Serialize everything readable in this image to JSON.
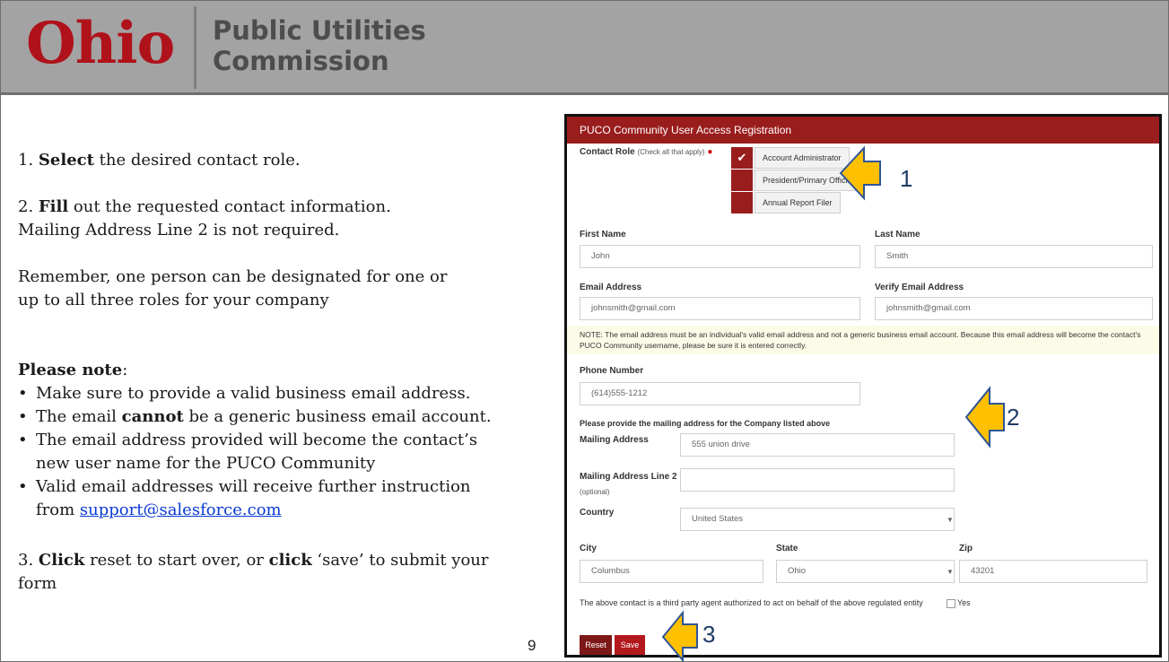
{
  "header": {
    "logo": "Ohio",
    "org_line1": "Public Utilities",
    "org_line2": "Commission"
  },
  "instructions": {
    "step1_bold": "Select",
    "step1_rest": " the desired contact role.",
    "step2_bold": "Fill",
    "step2_rest": " out the requested contact information.",
    "step2_line2": "Mailing Address Line 2 is not required.",
    "remember_line1": "Remember, one person can be designated for one or",
    "remember_line2": "up to all three roles for your company",
    "note_bold": "Please note",
    "note_colon": ":",
    "bullet1": "Make sure to provide a valid business email address.",
    "bullet2_pre": "The email ",
    "bullet2_bold": "cannot",
    "bullet2_post": " be a generic business email account.",
    "bullet3_line1": "The email address provided will become the contact’s",
    "bullet3_line2": "new user name for the PUCO Community",
    "bullet4_line1": "Valid email addresses will receive further instruction",
    "bullet4_pre": "from ",
    "bullet4_link": "support@salesforce.com",
    "step3_pre": "3. ",
    "step3_bold1": "Click",
    "step3_mid": " reset to start over, or ",
    "step3_bold2": "click",
    "step3_post": " ‘save’ to submit your",
    "step3_line2": "form",
    "step1_num": "1. ",
    "step2_num": "2. "
  },
  "slide_number": "9",
  "form": {
    "title": "PUCO Community User Access Registration",
    "contact_role_label": "Contact Role",
    "contact_role_hint": "(Check all that apply)",
    "roles": [
      {
        "label": "Account Administrator",
        "checked": true
      },
      {
        "label": "President/Primary Official",
        "checked": false
      },
      {
        "label": "Annual Report Filer",
        "checked": false
      }
    ],
    "check_glyph": "✔",
    "first_name_label": "First Name",
    "first_name_value": "John",
    "last_name_label": "Last Name",
    "last_name_value": "Smith",
    "email_label": "Email Address",
    "email_value": "johnsmith@gmail.com",
    "verify_email_label": "Verify Email Address",
    "verify_email_value": "johnsmith@gmail.com",
    "note_text": "NOTE: The email address must be an individual's valid email address and not a generic business email account. Because this email address will become the contact's PUCO Community username, please be sure it is entered correctly.",
    "phone_label": "Phone Number",
    "phone_value": "(614)555-1212",
    "mailing_intro": "Please provide the mailing address for the Company listed above",
    "mailing_label": "Mailing Address",
    "mailing_value": "555 union drive",
    "mailing2_label": "Mailing Address Line 2",
    "mailing2_hint": "(optional)",
    "mailing2_value": "",
    "country_label": "Country",
    "country_value": "United States",
    "city_label": "City",
    "city_value": "Columbus",
    "state_label": "State",
    "state_value": "Ohio",
    "zip_label": "Zip",
    "zip_value": "43201",
    "agent_text": "The above contact is a third party agent authorized to act on behalf of the above regulated entity",
    "agent_option": "Yes",
    "reset_label": "Reset",
    "save_label": "Save"
  },
  "callouts": [
    "1",
    "2",
    "3"
  ],
  "colors": {
    "brand_red": "#9a1d1d",
    "header_gray": "#a3a3a3",
    "arrow_fill": "#ffc000",
    "arrow_stroke": "#2f5597"
  }
}
